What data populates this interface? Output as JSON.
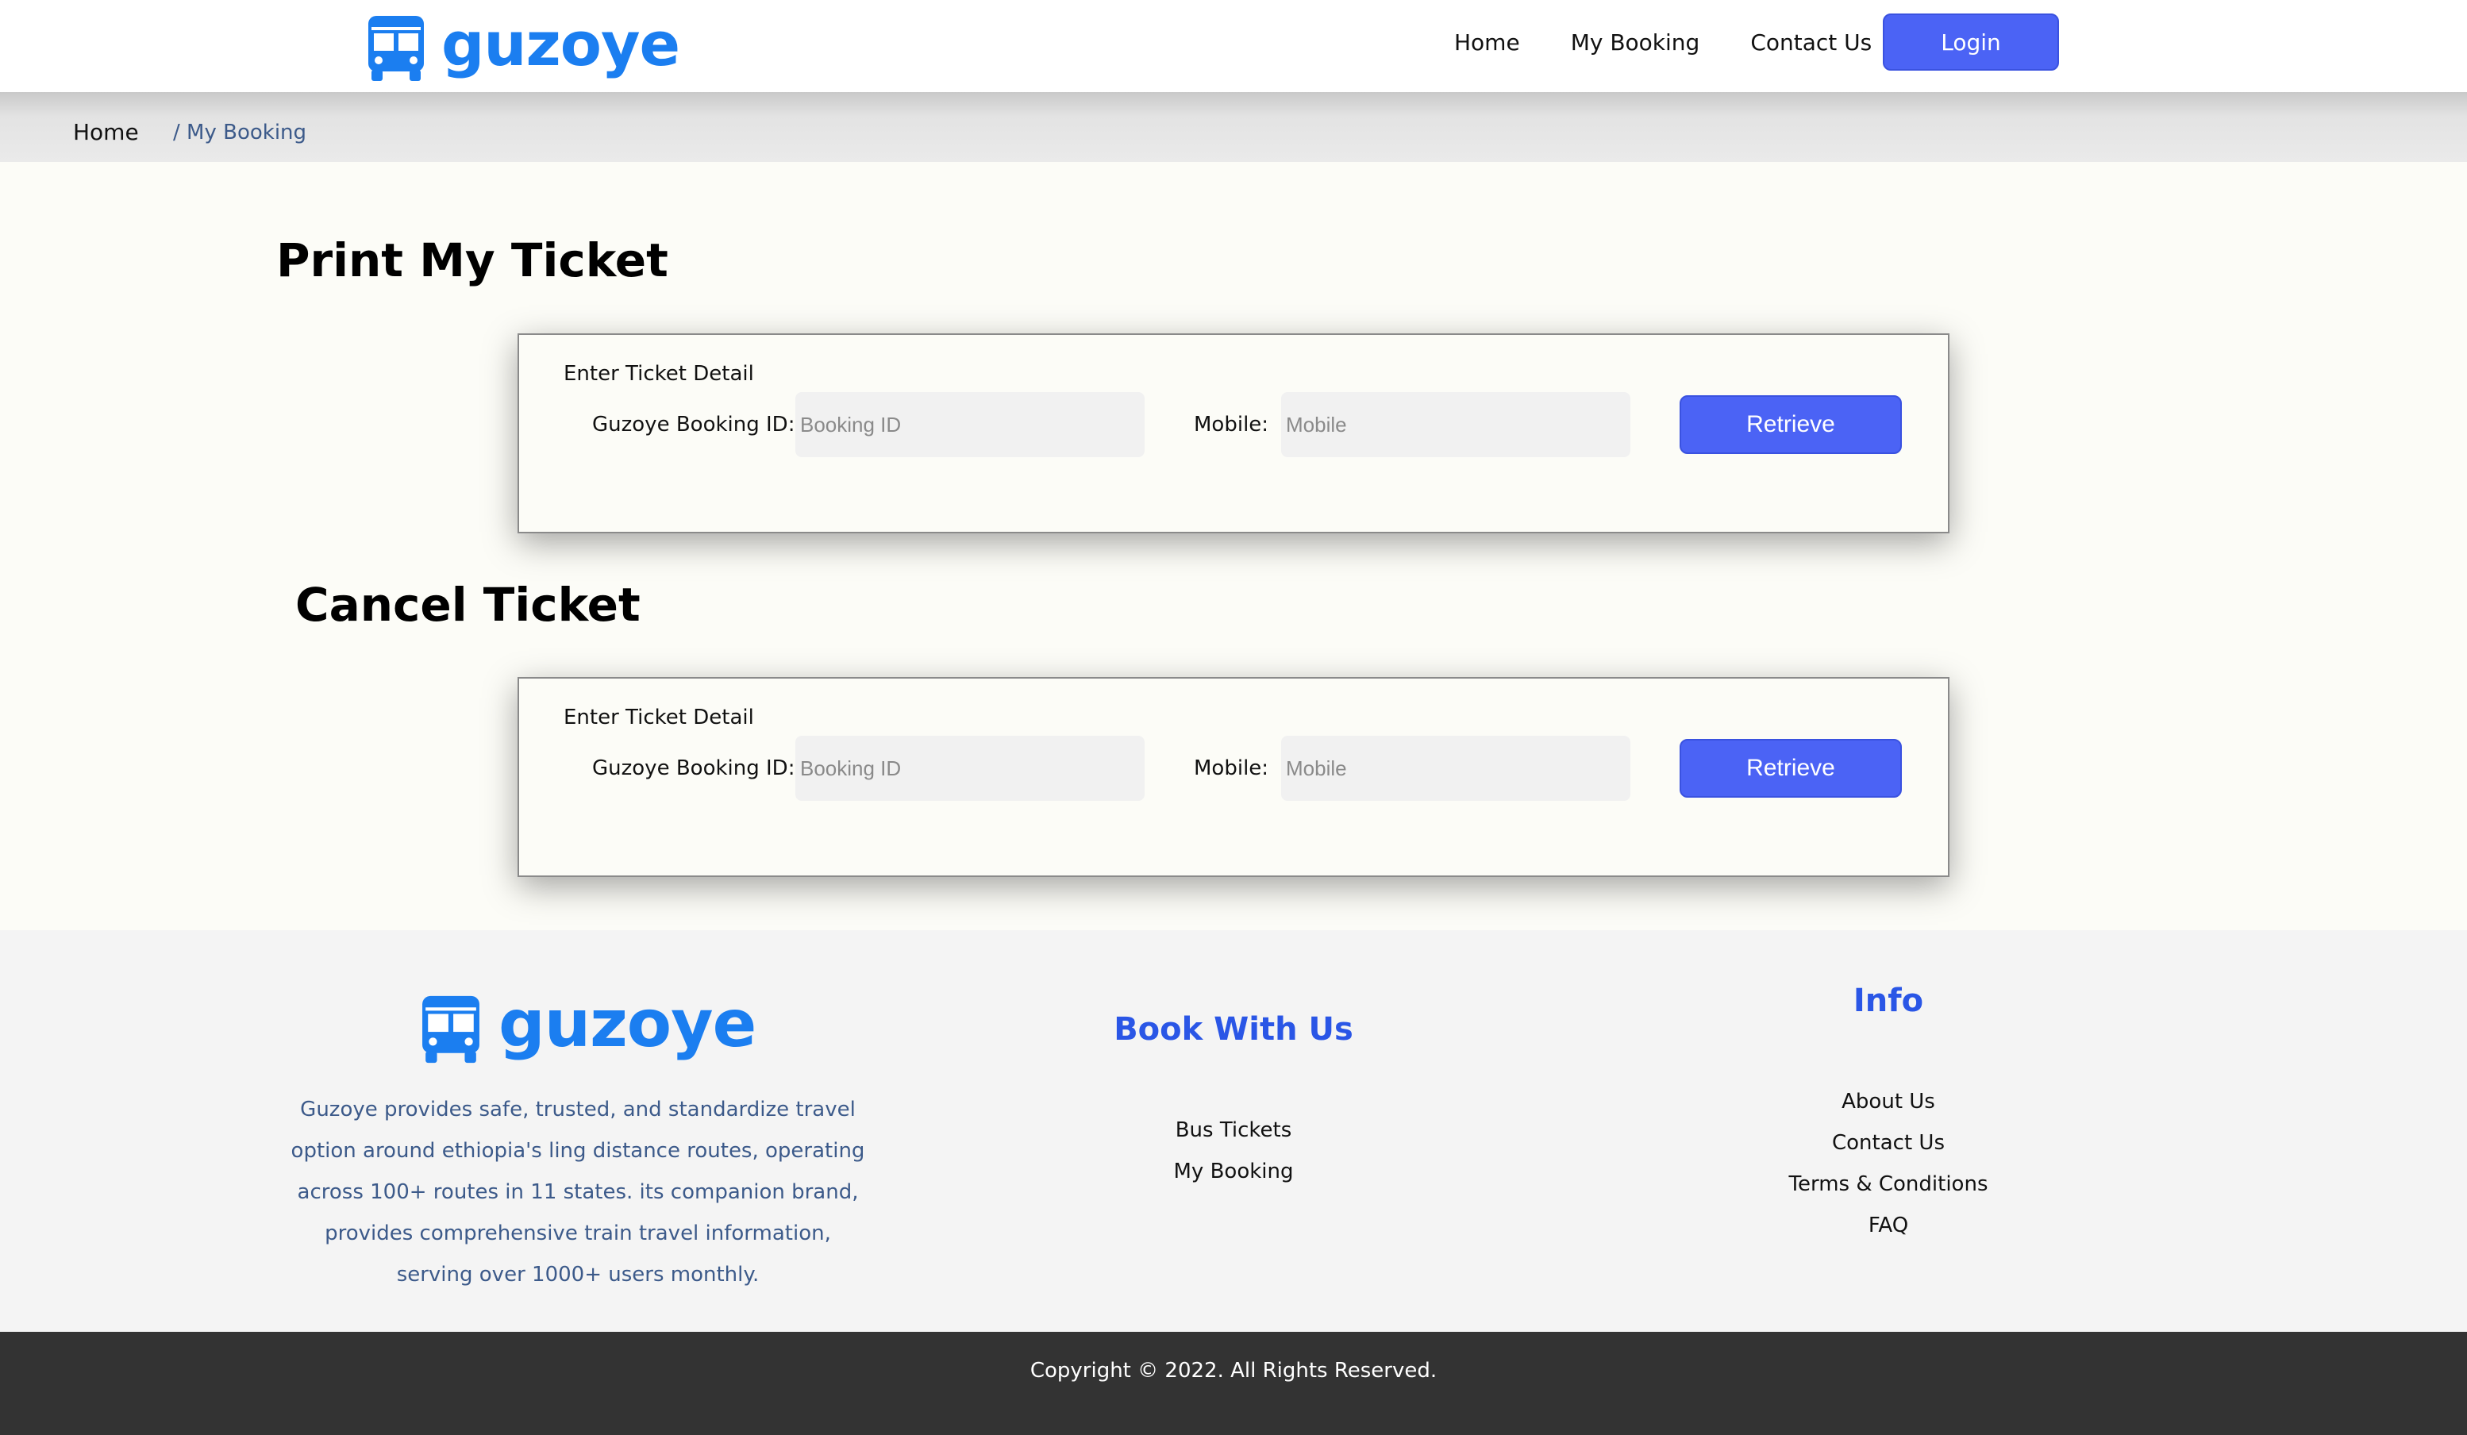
{
  "header": {
    "logo_text": "guzoye",
    "nav": [
      "Home",
      "My Booking",
      "Contact Us"
    ],
    "login_label": "Login"
  },
  "breadcrumb": {
    "home": "Home",
    "current": "/ My Booking"
  },
  "print_section": {
    "title": "Print My Ticket",
    "legend": "Enter Ticket Detail",
    "booking_label": "Guzoye Booking ID:",
    "booking_placeholder": "Booking ID",
    "mobile_label": "Mobile:",
    "mobile_placeholder": "Mobile",
    "button_label": "Retrieve"
  },
  "cancel_section": {
    "title": "Cancel Ticket",
    "legend": "Enter Ticket Detail",
    "booking_label": "Guzoye Booking ID:",
    "booking_placeholder": "Booking ID",
    "mobile_label": "Mobile:",
    "mobile_placeholder": "Mobile",
    "button_label": "Retrieve"
  },
  "footer": {
    "logo_text": "guzoye",
    "description": "Guzoye provides safe, trusted, and standardize travel option around ethiopia's ling distance routes, operating across 100+ routes in 11 states. its companion brand, provides comprehensive train travel information, serving over 1000+ users monthly.",
    "book_heading": "Book With Us",
    "book_links": [
      "Bus Tickets",
      "My Booking"
    ],
    "info_heading": "Info",
    "info_links": [
      "About Us",
      "Contact Us",
      "Terms & Conditions",
      "FAQ"
    ]
  },
  "copyright": "Copyright © 2022. All Rights Reserved.",
  "colors": {
    "brand_blue": "#1b7ef0",
    "button_blue": "#4b63f5",
    "heading_blue": "#2a56e6",
    "footer_bar": "#333333"
  },
  "icons": {
    "logo": "bus-icon"
  }
}
